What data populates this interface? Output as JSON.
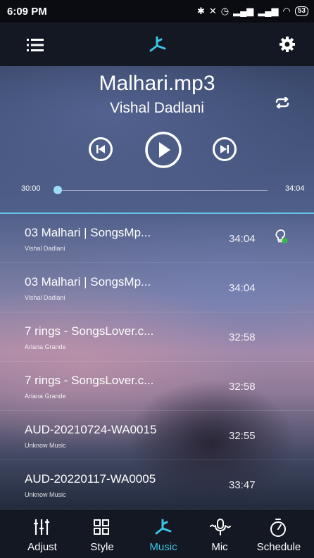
{
  "status_bar": {
    "time": "6:09 PM",
    "battery": "53"
  },
  "colors": {
    "accent": "#3cc4e6",
    "divider": "#5ec6e6",
    "seek_thumb": "#9cdcf2"
  },
  "header": {
    "menu_icon": "menu-icon",
    "logo_icon": "music-note-icon",
    "settings_icon": "gear-icon"
  },
  "now_playing": {
    "title": "Malhari.mp3",
    "artist": "Vishal Dadlani",
    "elapsed": "30:00",
    "total": "34:04",
    "progress": 0.02
  },
  "playlist": [
    {
      "title": "03 Malhari | SongsMp...",
      "artist": "Vishal Dadlani",
      "duration": "34:04",
      "playing": true
    },
    {
      "title": "03 Malhari | SongsMp...",
      "artist": "Vishal Dadlani",
      "duration": "34:04",
      "playing": false
    },
    {
      "title": "7 rings - SongsLover.c...",
      "artist": "Ariana Grande",
      "duration": "32:58",
      "playing": false
    },
    {
      "title": "7 rings - SongsLover.c...",
      "artist": "Ariana Grande",
      "duration": "32:58",
      "playing": false
    },
    {
      "title": "AUD-20210724-WA0015",
      "artist": "Unknow Music",
      "duration": "32:55",
      "playing": false
    },
    {
      "title": "AUD-20220117-WA0005",
      "artist": "Unknow Music",
      "duration": "33:47",
      "playing": false
    }
  ],
  "bottom_nav": [
    {
      "label": "Adjust",
      "icon": "equalizer-icon",
      "active": false
    },
    {
      "label": "Style",
      "icon": "grid-icon",
      "active": false
    },
    {
      "label": "Music",
      "icon": "music-note-icon",
      "active": true
    },
    {
      "label": "Mic",
      "icon": "microphone-icon",
      "active": false
    },
    {
      "label": "Schedule",
      "icon": "timer-icon",
      "active": false
    }
  ]
}
